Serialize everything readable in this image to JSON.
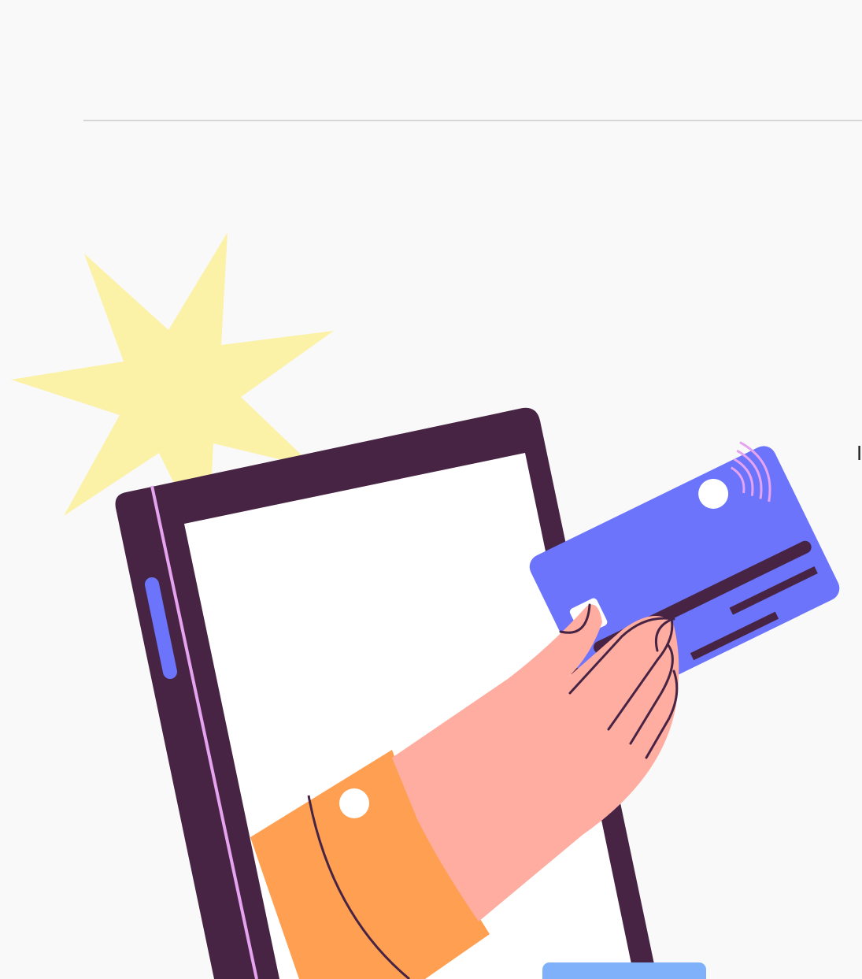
{
  "page": {
    "edge_text": "I"
  },
  "illustration": {
    "subject": "hand-holding-credit-card-from-tablet",
    "colors": {
      "background": "#f9f9f9",
      "starburst": "#fbf1a7",
      "tablet_frame": "#472443",
      "tablet_screen": "#ffffff",
      "tablet_accent_line": "#e6a3f0",
      "tablet_side_button": "#6b74fb",
      "card": "#6b74fb",
      "card_stripes": "#472443",
      "contactless": "#e6a3f0",
      "hand": "#ffaca1",
      "sleeve": "#ff9f51",
      "button_bottom": "#7fb1fb"
    }
  }
}
